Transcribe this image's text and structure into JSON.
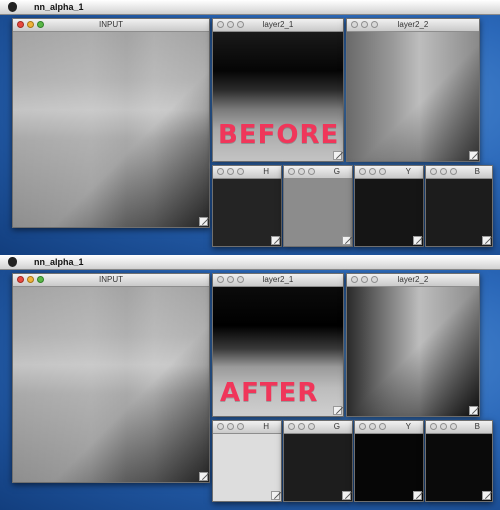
{
  "menubar": {
    "app_name": "nn_alpha_1"
  },
  "window_titles": {
    "input": "INPUT",
    "layer1": "layer2_1",
    "layer2": "layer2_2",
    "h": "H",
    "g": "G",
    "y": "Y",
    "b": "B"
  },
  "labels": {
    "before": "BEFORE",
    "after": "AFTER"
  },
  "colors": {
    "overlay_text": "#f0365a",
    "h_before": "#242424",
    "g_before": "#8c8c8c",
    "y_before": "#151515",
    "b_before": "#1c1c1c",
    "h_after": "#dddddd",
    "g_after": "#1d1d1d",
    "y_after": "#060606",
    "b_after": "#0a0a0a"
  }
}
